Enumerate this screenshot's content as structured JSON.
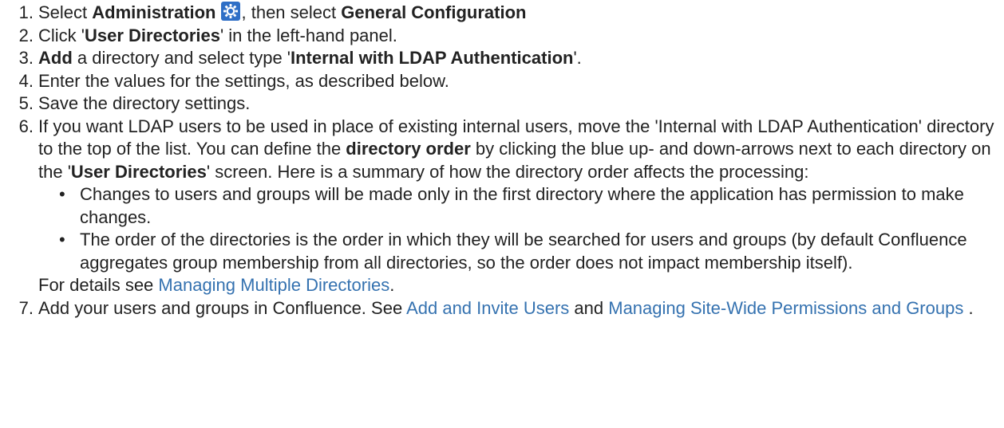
{
  "steps": [
    {
      "num": "1.",
      "t1": "Select ",
      "b1": "Administration",
      "icon": "gear-icon",
      "t2": ", then select ",
      "b2": "General Configuration"
    },
    {
      "num": "2.",
      "t1": "Click '",
      "b1": "User Directories",
      "t2": "' in the left-hand panel."
    },
    {
      "num": "3.",
      "b1": "Add",
      "t1": " a directory and select type '",
      "b2": "Internal with LDAP Authentication",
      "t2": "'."
    },
    {
      "num": "4.",
      "t1": "Enter the values for the settings, as described below."
    },
    {
      "num": "5.",
      "t1": "Save the directory settings."
    },
    {
      "num": "6.",
      "t1": "If you want LDAP users to be used in place of existing internal users, move the 'Internal with LDAP Authentication' directory to the top of the list. You can define the ",
      "b1": "directory order",
      "t2": " by clicking the blue up- and down-arrows next to each directory on the '",
      "b2": "User Directories",
      "t3": "' screen. Here is a summary of how the directory order affects the processing:",
      "bullets": [
        "Changes to users and groups will be made only in the first directory where the application has permission to make changes.",
        "The order of the directories is the order in which they will be searched for users and groups (by default Confluence aggregates group membership from all directories, so the order does not impact membership itself)."
      ],
      "details_prefix": "For details see ",
      "details_link": "Managing Multiple Directories",
      "details_suffix": "."
    },
    {
      "num": "7.",
      "t1": "Add your users and groups in Confluence. See ",
      "link1": "Add and Invite Users",
      "t2": " and ",
      "link2": "Managing Site-Wide Permissions and Groups",
      "t3": " ."
    }
  ],
  "colors": {
    "text": "#222222",
    "link": "#3572b0",
    "icon_bg": "#2f6fc6"
  }
}
